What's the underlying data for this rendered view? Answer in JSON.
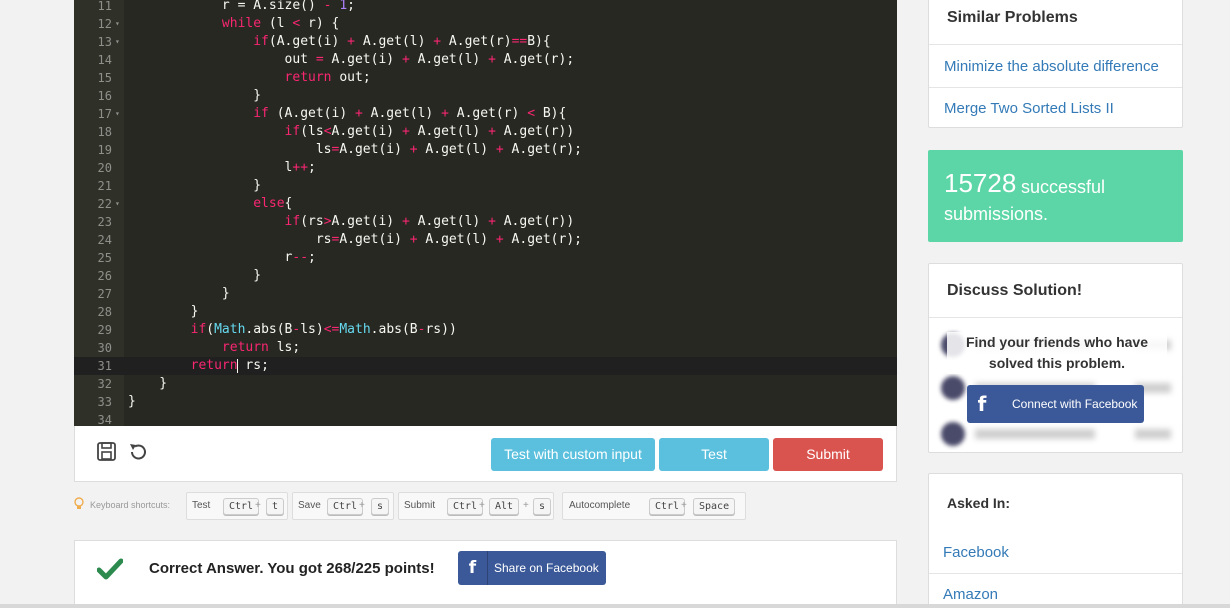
{
  "editor": {
    "lines": [
      {
        "n": "11",
        "fold": "",
        "html": "            r = A.size() <span class='k'>-</span> <span class='n'>1</span>;"
      },
      {
        "n": "12",
        "fold": "▾",
        "html": "            <span class='k'>while</span> (l <span class='k'>&lt;</span> r) {"
      },
      {
        "n": "13",
        "fold": "▾",
        "html": "                <span class='k'>if</span>(A.get(i) <span class='k'>+</span> A.get(l) <span class='k'>+</span> A.get(r)<span class='k'>==</span>B){"
      },
      {
        "n": "14",
        "fold": "",
        "html": "                    out <span class='k'>=</span> A.get(i) <span class='k'>+</span> A.get(l) <span class='k'>+</span> A.get(r);"
      },
      {
        "n": "15",
        "fold": "",
        "html": "                    <span class='k'>return</span> out;"
      },
      {
        "n": "16",
        "fold": "",
        "html": "                }"
      },
      {
        "n": "17",
        "fold": "▾",
        "html": "                <span class='k'>if</span> (A.get(i) <span class='k'>+</span> A.get(l) <span class='k'>+</span> A.get(r) <span class='k'>&lt;</span> B){"
      },
      {
        "n": "18",
        "fold": "",
        "html": "                    <span class='k'>if</span>(ls<span class='k'>&lt;</span>A.get(i) <span class='k'>+</span> A.get(l) <span class='k'>+</span> A.get(r))"
      },
      {
        "n": "19",
        "fold": "",
        "html": "                        ls<span class='k'>=</span>A.get(i) <span class='k'>+</span> A.get(l) <span class='k'>+</span> A.get(r);"
      },
      {
        "n": "20",
        "fold": "",
        "html": "                    l<span class='k'>++</span>;"
      },
      {
        "n": "21",
        "fold": "",
        "html": "                }"
      },
      {
        "n": "22",
        "fold": "▾",
        "html": "                <span class='k'>else</span>{"
      },
      {
        "n": "23",
        "fold": "",
        "html": "                    <span class='k'>if</span>(rs<span class='k'>&gt;</span>A.get(i) <span class='k'>+</span> A.get(l) <span class='k'>+</span> A.get(r))"
      },
      {
        "n": "24",
        "fold": "",
        "html": "                        rs<span class='k'>=</span>A.get(i) <span class='k'>+</span> A.get(l) <span class='k'>+</span> A.get(r);"
      },
      {
        "n": "25",
        "fold": "",
        "html": "                    r<span class='k'>--</span>;"
      },
      {
        "n": "26",
        "fold": "",
        "html": "                }"
      },
      {
        "n": "27",
        "fold": "",
        "html": "            }"
      },
      {
        "n": "28",
        "fold": "",
        "html": "        }"
      },
      {
        "n": "29",
        "fold": "",
        "html": "        <span class='k'>if</span>(<span class='c'>Math</span>.abs(B<span class='k'>-</span>ls)<span class='k'>&lt;=</span><span class='c'>Math</span>.abs(B<span class='k'>-</span>rs))"
      },
      {
        "n": "30",
        "fold": "",
        "html": "            <span class='k'>return</span> ls;"
      },
      {
        "n": "31",
        "fold": "",
        "html": "        <span class='k'>return</span><span class='cursor'></span> rs;"
      },
      {
        "n": "32",
        "fold": "",
        "html": "    }"
      },
      {
        "n": "33",
        "fold": "",
        "html": "}"
      },
      {
        "n": "34",
        "fold": "",
        "html": ""
      }
    ],
    "active_line": "31"
  },
  "actions": {
    "save_icon": "save-icon",
    "reset_icon": "reset-icon",
    "custom_input_label": "Test with custom input",
    "test_label": "Test",
    "submit_label": "Submit",
    "test_color": "#5bc0de",
    "submit_color": "#d9534f"
  },
  "shortcuts": {
    "title": "Keyboard shortcuts:",
    "groups": [
      {
        "name": "Test",
        "keys": [
          "Ctrl",
          "t"
        ]
      },
      {
        "name": "Save",
        "keys": [
          "Ctrl",
          "s"
        ]
      },
      {
        "name": "Submit",
        "keys": [
          "Ctrl",
          "Alt",
          "s"
        ]
      },
      {
        "name": "Autocomplete",
        "keys": [
          "Ctrl",
          "Space"
        ]
      }
    ]
  },
  "result": {
    "message": "Correct Answer. You got 268/225 points!",
    "share_label": "Share on Facebook",
    "check_color": "#2d8a4e"
  },
  "similar": {
    "title": "Similar Problems",
    "items": [
      "Minimize the absolute difference",
      "Merge Two Sorted Lists II"
    ]
  },
  "stats": {
    "count": "15728",
    "text1": "successful",
    "text2": "submissions.",
    "color": "#5cd6a6"
  },
  "discuss": {
    "title": "Discuss Solution!",
    "find_text": "Find your friends who have solved this problem.",
    "connect_label": "Connect with Facebook"
  },
  "asked": {
    "title": "Asked In:",
    "companies": [
      "Facebook",
      "Amazon"
    ]
  }
}
